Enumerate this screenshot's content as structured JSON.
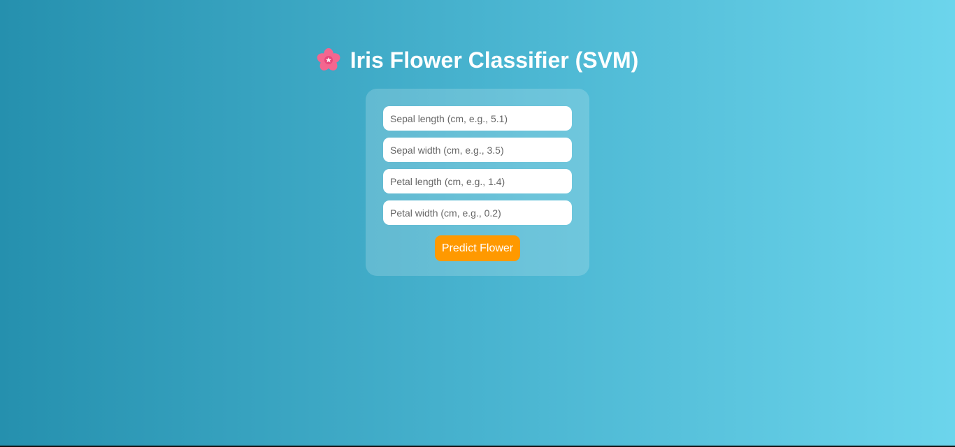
{
  "header": {
    "icon": "cherry-blossom-icon",
    "title": "Iris Flower Classifier (SVM)"
  },
  "form": {
    "fields": [
      {
        "placeholder": "Sepal length (cm, e.g., 5.1)",
        "value": ""
      },
      {
        "placeholder": "Sepal width (cm, e.g., 3.5)",
        "value": ""
      },
      {
        "placeholder": "Petal length (cm, e.g., 1.4)",
        "value": ""
      },
      {
        "placeholder": "Petal width (cm, e.g., 0.2)",
        "value": ""
      }
    ],
    "submit_label": "Predict Flower"
  },
  "colors": {
    "gradient_start": "#2590ae",
    "gradient_end": "#6cd5ec",
    "button": "#ff9900",
    "title_text": "#ffffff"
  }
}
